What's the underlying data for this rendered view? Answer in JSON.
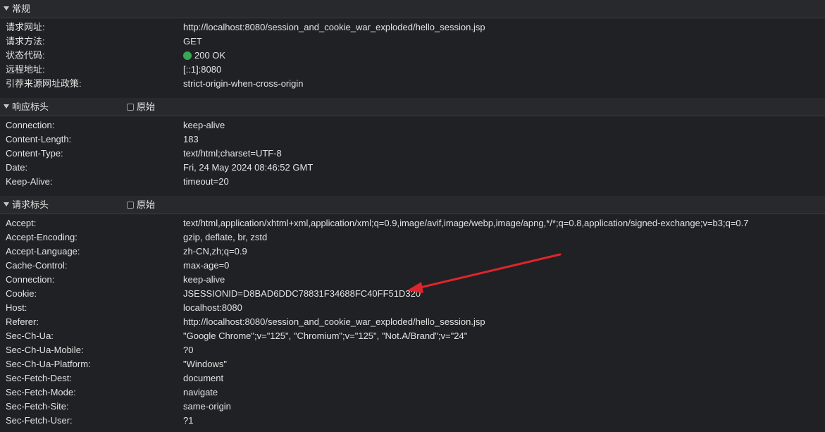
{
  "general": {
    "title": "常规",
    "rows": [
      {
        "key": "请求网址:",
        "value": "http://localhost:8080/session_and_cookie_war_exploded/hello_session.jsp"
      },
      {
        "key": "请求方法:",
        "value": "GET"
      },
      {
        "key": "状态代码:",
        "value": "200 OK"
      },
      {
        "key": "远程地址:",
        "value": "[::1]:8080"
      },
      {
        "key": "引荐来源网址政策:",
        "value": "strict-origin-when-cross-origin"
      }
    ]
  },
  "response_headers": {
    "title": "响应标头",
    "raw_label": "原始",
    "rows": [
      {
        "key": "Connection:",
        "value": "keep-alive"
      },
      {
        "key": "Content-Length:",
        "value": "183"
      },
      {
        "key": "Content-Type:",
        "value": "text/html;charset=UTF-8"
      },
      {
        "key": "Date:",
        "value": "Fri, 24 May 2024 08:46:52 GMT"
      },
      {
        "key": "Keep-Alive:",
        "value": "timeout=20"
      }
    ]
  },
  "request_headers": {
    "title": "请求标头",
    "raw_label": "原始",
    "rows": [
      {
        "key": "Accept:",
        "value": "text/html,application/xhtml+xml,application/xml;q=0.9,image/avif,image/webp,image/apng,*/*;q=0.8,application/signed-exchange;v=b3;q=0.7"
      },
      {
        "key": "Accept-Encoding:",
        "value": "gzip, deflate, br, zstd"
      },
      {
        "key": "Accept-Language:",
        "value": "zh-CN,zh;q=0.9"
      },
      {
        "key": "Cache-Control:",
        "value": "max-age=0"
      },
      {
        "key": "Connection:",
        "value": "keep-alive"
      },
      {
        "key": "Cookie:",
        "value": "JSESSIONID=D8BAD6DDC78831F34688FC40FF51D320"
      },
      {
        "key": "Host:",
        "value": "localhost:8080"
      },
      {
        "key": "Referer:",
        "value": "http://localhost:8080/session_and_cookie_war_exploded/hello_session.jsp"
      },
      {
        "key": "Sec-Ch-Ua:",
        "value": "\"Google Chrome\";v=\"125\", \"Chromium\";v=\"125\", \"Not.A/Brand\";v=\"24\""
      },
      {
        "key": "Sec-Ch-Ua-Mobile:",
        "value": "?0"
      },
      {
        "key": "Sec-Ch-Ua-Platform:",
        "value": "\"Windows\""
      },
      {
        "key": "Sec-Fetch-Dest:",
        "value": "document"
      },
      {
        "key": "Sec-Fetch-Mode:",
        "value": "navigate"
      },
      {
        "key": "Sec-Fetch-Site:",
        "value": "same-origin"
      },
      {
        "key": "Sec-Fetch-User:",
        "value": "?1"
      }
    ]
  },
  "colors": {
    "background": "#202124",
    "header_bg": "#28292c",
    "status_ok": "#34a853",
    "annotation_arrow": "#e0242c"
  },
  "icons": {
    "section_toggle": "triangle-down-icon",
    "status": "green-dot-icon"
  }
}
